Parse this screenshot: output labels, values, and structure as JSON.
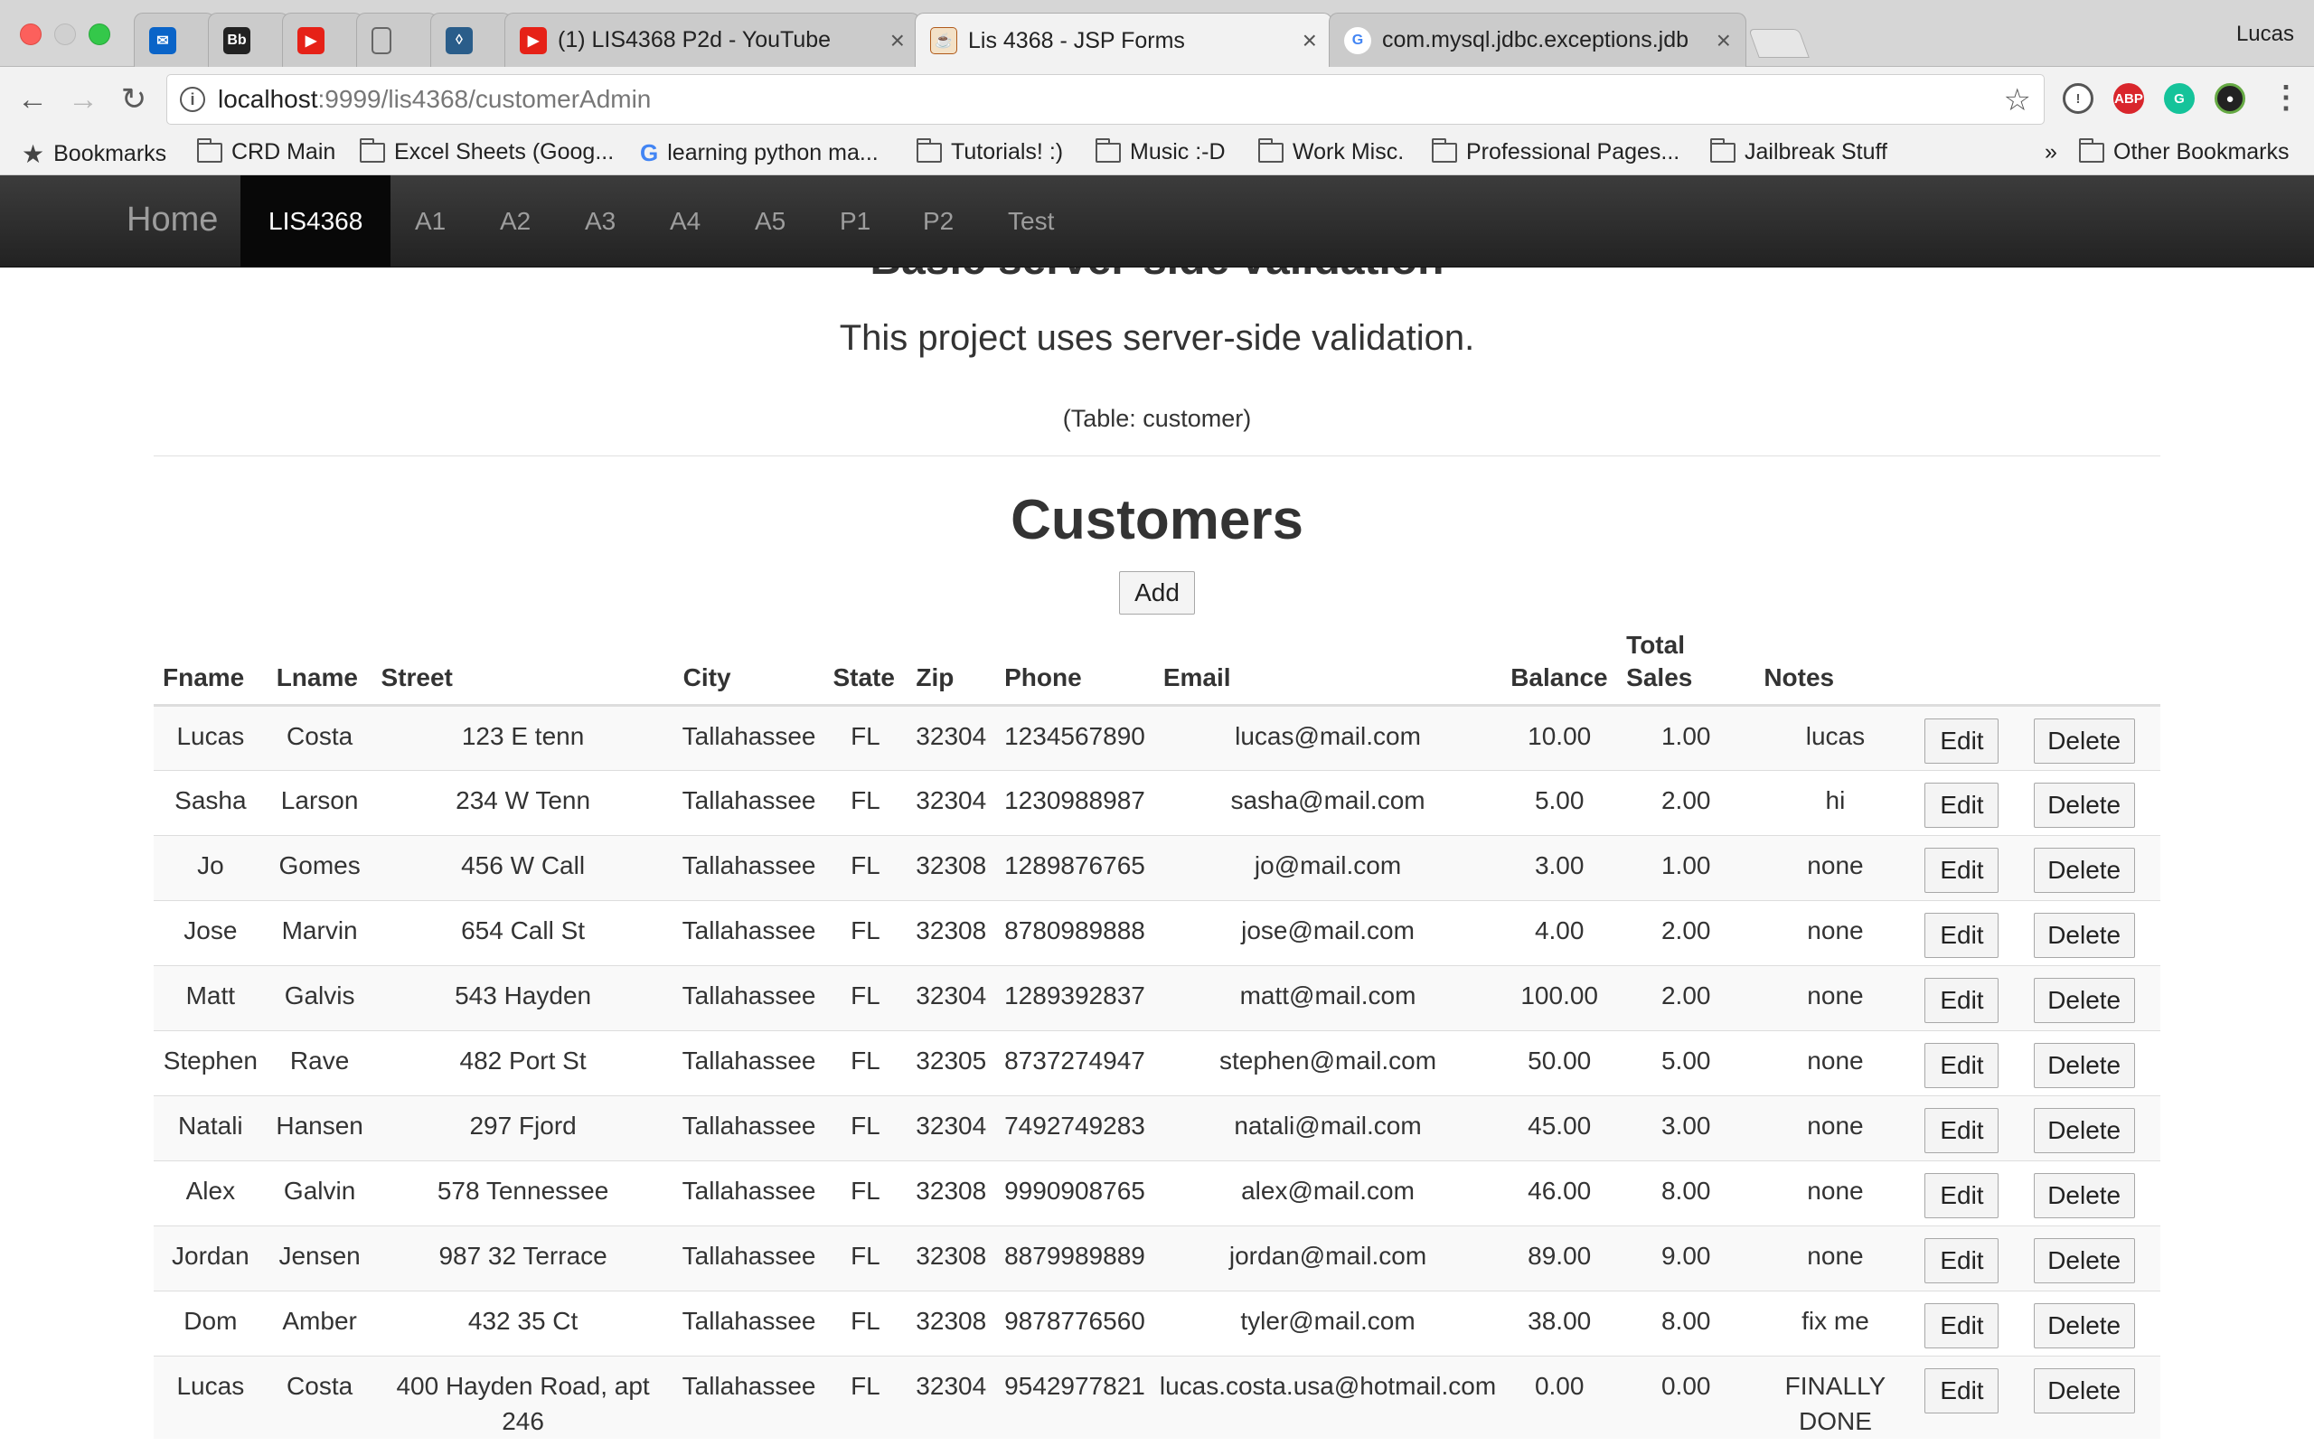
{
  "browser": {
    "profile_name": "Lucas",
    "tabs": [
      {
        "title": "",
        "icon": "outlook-icon"
      },
      {
        "title": "",
        "icon": "blackboard-icon",
        "icon_text": "Bb"
      },
      {
        "title": "",
        "icon": "youtube-icon"
      },
      {
        "title": "",
        "icon": "document-icon"
      },
      {
        "title": "",
        "icon": "shield-icon"
      },
      {
        "title": "(1) LIS4368 P2d - YouTube",
        "icon": "youtube-icon"
      },
      {
        "title": "Lis 4368 - JSP Forms",
        "icon": "java-icon"
      },
      {
        "title": "com.mysql.jdbc.exceptions.jdb",
        "icon": "google-icon"
      }
    ],
    "url_host": "localhost",
    "url_path": ":9999/lis4368/customerAdmin",
    "bookmarks": [
      {
        "label": "Bookmarks",
        "icon": "star-icon"
      },
      {
        "label": "CRD Main",
        "icon": "folder-icon"
      },
      {
        "label": "Excel Sheets (Goog...",
        "icon": "folder-icon"
      },
      {
        "label": "learning python ma...",
        "icon": "google-icon"
      },
      {
        "label": "Tutorials! :)",
        "icon": "folder-icon"
      },
      {
        "label": "Music :-D",
        "icon": "folder-icon"
      },
      {
        "label": "Work Misc.",
        "icon": "folder-icon"
      },
      {
        "label": "Professional Pages...",
        "icon": "folder-icon"
      },
      {
        "label": "Jailbreak Stuff",
        "icon": "folder-icon"
      },
      {
        "label": "»",
        "icon": ""
      },
      {
        "label": "Other Bookmarks",
        "icon": "folder-icon"
      }
    ]
  },
  "site": {
    "brand": "Home",
    "nav": [
      "LIS4368",
      "A1",
      "A2",
      "A3",
      "A4",
      "A5",
      "P1",
      "P2",
      "Test"
    ],
    "active_nav": "LIS4368"
  },
  "page": {
    "heading": "Basic server-side validation",
    "lead": "This project uses server-side validation.",
    "caption": "(Table: customer)",
    "title": "Customers",
    "add_label": "Add"
  },
  "table": {
    "headers": [
      "Fname",
      "Lname",
      "Street",
      "City",
      "State",
      "Zip",
      "Phone",
      "Email",
      "Balance",
      "Total Sales",
      "Notes"
    ],
    "edit_label": "Edit",
    "delete_label": "Delete",
    "rows": [
      [
        "Lucas",
        "Costa",
        "123 E tenn",
        "Tallahassee",
        "FL",
        "32304",
        "1234567890",
        "lucas@mail.com",
        "10.00",
        "1.00",
        "lucas"
      ],
      [
        "Sasha",
        "Larson",
        "234 W Tenn",
        "Tallahassee",
        "FL",
        "32304",
        "1230988987",
        "sasha@mail.com",
        "5.00",
        "2.00",
        "hi"
      ],
      [
        "Jo",
        "Gomes",
        "456 W Call",
        "Tallahassee",
        "FL",
        "32308",
        "1289876765",
        "jo@mail.com",
        "3.00",
        "1.00",
        "none"
      ],
      [
        "Jose",
        "Marvin",
        "654 Call St",
        "Tallahassee",
        "FL",
        "32308",
        "8780989888",
        "jose@mail.com",
        "4.00",
        "2.00",
        "none"
      ],
      [
        "Matt",
        "Galvis",
        "543 Hayden",
        "Tallahassee",
        "FL",
        "32304",
        "1289392837",
        "matt@mail.com",
        "100.00",
        "2.00",
        "none"
      ],
      [
        "Stephen",
        "Rave",
        "482 Port St",
        "Tallahassee",
        "FL",
        "32305",
        "8737274947",
        "stephen@mail.com",
        "50.00",
        "5.00",
        "none"
      ],
      [
        "Natali",
        "Hansen",
        "297 Fjord",
        "Tallahassee",
        "FL",
        "32304",
        "7492749283",
        "natali@mail.com",
        "45.00",
        "3.00",
        "none"
      ],
      [
        "Alex",
        "Galvin",
        "578 Tennessee",
        "Tallahassee",
        "FL",
        "32308",
        "9990908765",
        "alex@mail.com",
        "46.00",
        "8.00",
        "none"
      ],
      [
        "Jordan",
        "Jensen",
        "987 32 Terrace",
        "Tallahassee",
        "FL",
        "32308",
        "8879989889",
        "jordan@mail.com",
        "89.00",
        "9.00",
        "none"
      ],
      [
        "Dom",
        "Amber",
        "432 35 Ct",
        "Tallahassee",
        "FL",
        "32308",
        "9878776560",
        "tyler@mail.com",
        "38.00",
        "8.00",
        "fix me"
      ],
      [
        "Lucas",
        "Costa",
        "400 Hayden Road, apt 246",
        "Tallahassee",
        "FL",
        "32304",
        "9542977821",
        "lucas.costa.usa@hotmail.com",
        "0.00",
        "0.00",
        "FINALLY DONE"
      ]
    ]
  },
  "colors": {
    "navbar": "#222222",
    "navbar_active": "#080808",
    "stripe": "#f9f9f9"
  }
}
